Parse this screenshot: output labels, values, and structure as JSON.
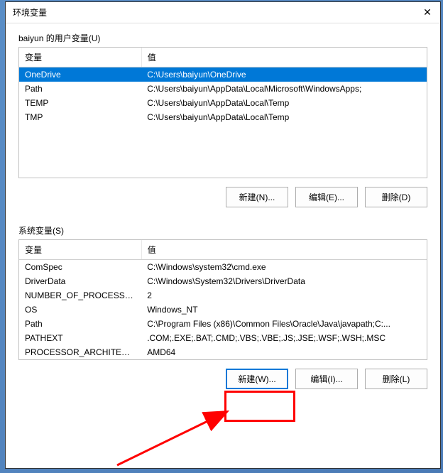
{
  "window": {
    "title": "环境变量"
  },
  "user_section": {
    "label": "baiyun 的用户变量(U)",
    "headers": {
      "var": "变量",
      "val": "值"
    },
    "rows": [
      {
        "var": "OneDrive",
        "val": "C:\\Users\\baiyun\\OneDrive",
        "selected": true
      },
      {
        "var": "Path",
        "val": "C:\\Users\\baiyun\\AppData\\Local\\Microsoft\\WindowsApps;",
        "selected": false
      },
      {
        "var": "TEMP",
        "val": "C:\\Users\\baiyun\\AppData\\Local\\Temp",
        "selected": false
      },
      {
        "var": "TMP",
        "val": "C:\\Users\\baiyun\\AppData\\Local\\Temp",
        "selected": false
      }
    ],
    "buttons": {
      "new": "新建(N)...",
      "edit": "编辑(E)...",
      "delete": "删除(D)"
    }
  },
  "system_section": {
    "label": "系统变量(S)",
    "headers": {
      "var": "变量",
      "val": "值"
    },
    "rows": [
      {
        "var": "ComSpec",
        "val": "C:\\Windows\\system32\\cmd.exe"
      },
      {
        "var": "DriverData",
        "val": "C:\\Windows\\System32\\Drivers\\DriverData"
      },
      {
        "var": "NUMBER_OF_PROCESSORS",
        "val": "2"
      },
      {
        "var": "OS",
        "val": "Windows_NT"
      },
      {
        "var": "Path",
        "val": "C:\\Program Files (x86)\\Common Files\\Oracle\\Java\\javapath;C:..."
      },
      {
        "var": "PATHEXT",
        "val": ".COM;.EXE;.BAT;.CMD;.VBS;.VBE;.JS;.JSE;.WSF;.WSH;.MSC"
      },
      {
        "var": "PROCESSOR_ARCHITECT...",
        "val": "AMD64"
      }
    ],
    "buttons": {
      "new": "新建(W)...",
      "edit": "编辑(I)...",
      "delete": "删除(L)"
    }
  }
}
